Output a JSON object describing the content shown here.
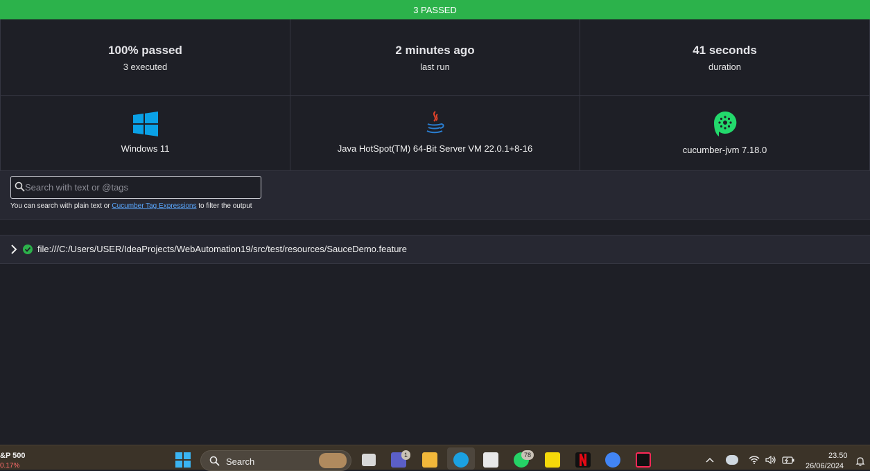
{
  "banner": {
    "text": "3 PASSED"
  },
  "stats": [
    {
      "value": "100% passed",
      "label": "3 executed"
    },
    {
      "value": "2 minutes ago",
      "label": "last run"
    },
    {
      "value": "41 seconds",
      "label": "duration"
    }
  ],
  "environment": [
    {
      "icon": "windows-icon",
      "label": "Windows 11"
    },
    {
      "icon": "java-icon",
      "label": "Java HotSpot(TM) 64-Bit Server VM 22.0.1+8-16"
    },
    {
      "icon": "cucumber-icon",
      "label": "cucumber-jvm 7.18.0"
    }
  ],
  "search": {
    "placeholder": "Search with text or @tags",
    "hint_prefix": "You can search with plain text or ",
    "hint_link": "Cucumber Tag Expressions",
    "hint_suffix": " to filter the output"
  },
  "feature": {
    "path": "file:///C:/Users/USER/IdeaProjects/WebAutomation19/src/test/resources/SauceDemo.feature",
    "status": "passed"
  },
  "taskbar": {
    "stock_name": "&P 500",
    "stock_change": "0.17%",
    "search_label": "Search",
    "teams_badge": "1",
    "whatsapp_badge": "78",
    "time": "23.50",
    "date": "26/06/2024"
  },
  "colors": {
    "passed": "#2cb24b",
    "background": "#1e1f26",
    "link": "#5aa8ff"
  }
}
